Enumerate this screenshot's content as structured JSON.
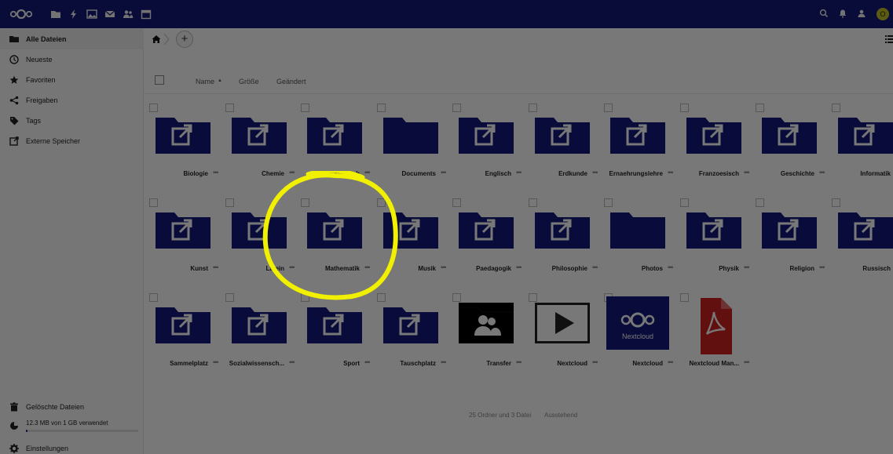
{
  "colors": {
    "brand": "#14197e",
    "folder": "#14197e",
    "highlight": "#ffff00"
  },
  "topbar": {
    "apps": [
      {
        "name": "files",
        "icon": "folder-icon"
      },
      {
        "name": "activity",
        "icon": "lightning-icon"
      },
      {
        "name": "gallery",
        "icon": "image-icon"
      },
      {
        "name": "mail",
        "icon": "mail-icon"
      },
      {
        "name": "contacts",
        "icon": "contacts-icon"
      },
      {
        "name": "calendar",
        "icon": "calendar-icon"
      }
    ],
    "avatar_initial": "O"
  },
  "sidebar": {
    "items": [
      {
        "label": "Alle Dateien",
        "icon": "folder-icon",
        "active": true
      },
      {
        "label": "Neueste",
        "icon": "clock-icon"
      },
      {
        "label": "Favoriten",
        "icon": "star-icon"
      },
      {
        "label": "Freigaben",
        "icon": "share-icon"
      },
      {
        "label": "Tags",
        "icon": "tag-icon"
      },
      {
        "label": "Externe Speicher",
        "icon": "external-storage-icon"
      }
    ],
    "trash_label": "Gelöschte Dateien",
    "quota_label": "12.3 MB von 1 GB verwendet",
    "quota_fraction": 0.012,
    "settings_label": "Einstellungen"
  },
  "toolbar": {
    "add_label": "+"
  },
  "columns": {
    "name": "Name",
    "sort_indicator": "▲",
    "size": "Größe",
    "modified": "Geändert"
  },
  "files": [
    {
      "name": "Biologie",
      "type": "shared-folder"
    },
    {
      "name": "Chemie",
      "type": "shared-folder"
    },
    {
      "name": "Deutsch",
      "type": "shared-folder"
    },
    {
      "name": "Documents",
      "type": "folder"
    },
    {
      "name": "Englisch",
      "type": "shared-folder"
    },
    {
      "name": "Erdkunde",
      "type": "shared-folder"
    },
    {
      "name": "Ernaehrungslehre",
      "type": "shared-folder"
    },
    {
      "name": "Franzoesisch",
      "type": "shared-folder"
    },
    {
      "name": "Geschichte",
      "type": "shared-folder"
    },
    {
      "name": "Informatik",
      "type": "shared-folder"
    },
    {
      "name": "Kunst",
      "type": "shared-folder"
    },
    {
      "name": "Latein",
      "type": "shared-folder"
    },
    {
      "name": "Mathematik",
      "type": "shared-folder"
    },
    {
      "name": "Musik",
      "type": "shared-folder"
    },
    {
      "name": "Paedagogik",
      "type": "shared-folder"
    },
    {
      "name": "Philosophie",
      "type": "shared-folder"
    },
    {
      "name": "Photos",
      "type": "folder"
    },
    {
      "name": "Physik",
      "type": "shared-folder"
    },
    {
      "name": "Religion",
      "type": "shared-folder"
    },
    {
      "name": "Russisch",
      "type": "shared-folder"
    },
    {
      "name": "Sammelplatz",
      "type": "shared-folder"
    },
    {
      "name": "Sozialwissensch...",
      "type": "shared-folder"
    },
    {
      "name": "Sport",
      "type": "shared-folder"
    },
    {
      "name": "Tauschplatz",
      "type": "shared-folder"
    },
    {
      "name": "Transfer",
      "type": "contacts-folder"
    },
    {
      "name": "Nextcloud",
      "type": "video"
    },
    {
      "name": "Nextcloud",
      "type": "nextcloud-image"
    },
    {
      "name": "Nextcloud Man...",
      "type": "pdf"
    }
  ],
  "summary": {
    "count": "25 Ordner und 3 Datei",
    "pending": "Ausstehend"
  },
  "nextcloud_thumb_text": "Nextcloud",
  "actions_glyph": "•••"
}
